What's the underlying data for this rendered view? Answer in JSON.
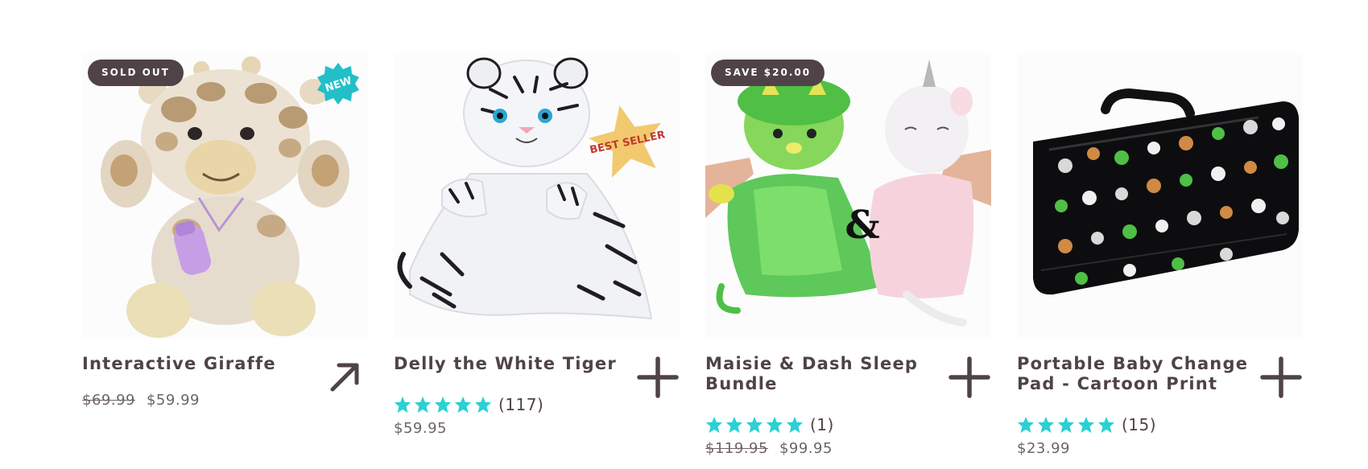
{
  "colors": {
    "text": "#4f4347",
    "badge_bg": "#4f4347",
    "star": "#2ad1d4",
    "action_icon": "#4f4347"
  },
  "products": [
    {
      "title": "Interactive Giraffe",
      "badge": "SOLD OUT",
      "overlay_label": "NEW",
      "action_icon": "arrow-up-right-icon",
      "rating": null,
      "compare_price": "$69.99",
      "price": "$59.99"
    },
    {
      "title": "Delly the White Tiger",
      "badge": "",
      "overlay_label": "BEST SELLER",
      "action_icon": "plus-icon",
      "rating": {
        "stars": 5,
        "count": "(117)"
      },
      "compare_price": "",
      "price": "$59.95"
    },
    {
      "title": "Maisie & Dash Sleep Bundle",
      "badge": "SAVE $20.00",
      "overlay_label": "&",
      "action_icon": "plus-icon",
      "rating": {
        "stars": 5,
        "count": "(1)"
      },
      "compare_price": "$119.95",
      "price": "$99.95"
    },
    {
      "title": "Portable Baby Change Pad - Cartoon Print",
      "badge": "",
      "overlay_label": "",
      "action_icon": "plus-icon",
      "rating": {
        "stars": 5,
        "count": "(15)"
      },
      "compare_price": "",
      "price": "$23.99"
    }
  ]
}
